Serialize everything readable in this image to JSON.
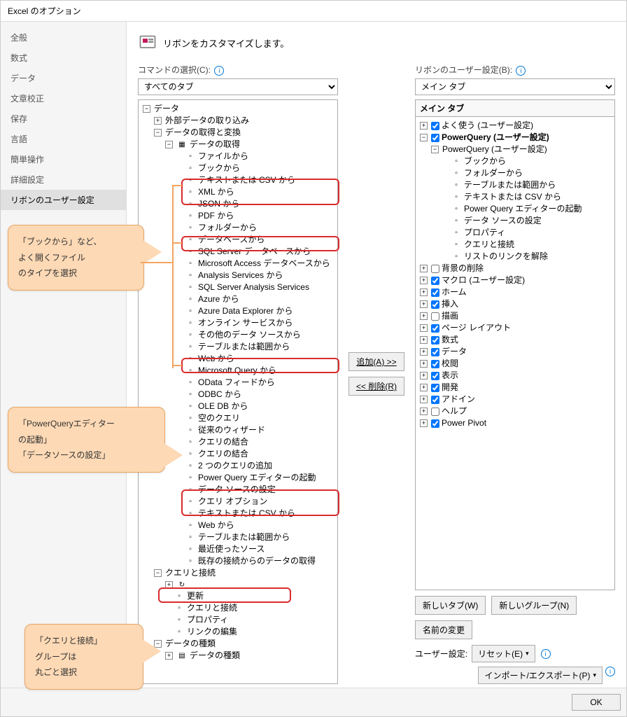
{
  "window_title": "Excel のオプション",
  "sidebar": {
    "items": [
      "全般",
      "数式",
      "データ",
      "文章校正",
      "保存",
      "言語",
      "簡単操作",
      "詳細設定",
      "リボンのユーザー設定"
    ]
  },
  "heading": "リボンをカスタマイズします。",
  "left_pane": {
    "label": "コマンドの選択(C):",
    "dropdown_value": "すべてのタブ",
    "root": "データ",
    "group1": "外部データの取り込み",
    "group2": "データの取得と変換",
    "group2_sub": "データの取得",
    "leaves_a": [
      "ファイルから",
      "ブックから",
      "テキストまたは CSV から",
      "XML から",
      "JSON から",
      "PDF から",
      "フォルダーから",
      "データベースから",
      "SQL Server データベースから",
      "Microsoft Access データベースから",
      "Analysis Services から",
      "SQL Server Analysis Services",
      "Azure から",
      "Azure Data Explorer から",
      "オンライン サービスから",
      "その他のデータ ソースから",
      "テーブルまたは範囲から",
      "Web から",
      "Microsoft Query から",
      "OData フィードから",
      "ODBC から",
      "OLE DB から",
      "空のクエリ",
      "従来のウィザード",
      "クエリの結合",
      "クエリの結合",
      "2 つのクエリの追加",
      "Power Query エディターの起動",
      "データ ソースの設定",
      "クエリ オプション"
    ],
    "leaves_b": [
      "テキストまたは CSV から",
      "Web から",
      "テーブルまたは範囲から",
      "最近使ったソース",
      "既存の接続からのデータの取得"
    ],
    "group3": "クエリと接続",
    "leaves_c": [
      "",
      "更新",
      "クエリと接続",
      "プロパティ",
      "リンクの編集"
    ],
    "group4": "データの種類",
    "group4_sub": "データの種類"
  },
  "center_buttons": {
    "add": "追加(A) >>",
    "remove": "<< 削除(R)"
  },
  "right_pane": {
    "label": "リボンのユーザー設定(B):",
    "dropdown_value": "メイン タブ",
    "header": "メイン タブ",
    "item_freq": "よく使う (ユーザー設定)",
    "item_pq_root": "PowerQuery (ユーザー設定)",
    "item_pq_group": "PowerQuery (ユーザー設定)",
    "pq_leaves": [
      "ブックから",
      "フォルダーから",
      "テーブルまたは範囲から",
      "テキストまたは CSV から",
      "Power Query エディターの起動",
      "データ ソースの設定",
      "プロパティ",
      "クエリと接続",
      "リストのリンクを解除"
    ],
    "std_items": [
      {
        "label": "背景の削除",
        "checked": false
      },
      {
        "label": "マクロ (ユーザー設定)",
        "checked": true
      },
      {
        "label": "ホーム",
        "checked": true
      },
      {
        "label": "挿入",
        "checked": true
      },
      {
        "label": "描画",
        "checked": false
      },
      {
        "label": "ページ レイアウト",
        "checked": true
      },
      {
        "label": "数式",
        "checked": true
      },
      {
        "label": "データ",
        "checked": true
      },
      {
        "label": "校閲",
        "checked": true
      },
      {
        "label": "表示",
        "checked": true
      },
      {
        "label": "開発",
        "checked": true
      },
      {
        "label": "アドイン",
        "checked": true
      },
      {
        "label": "ヘルプ",
        "checked": false
      },
      {
        "label": "Power Pivot",
        "checked": true
      }
    ]
  },
  "bottom": {
    "new_tab": "新しいタブ(W)",
    "new_group": "新しいグループ(N)",
    "rename": "名前の変更",
    "user_settings_label": "ユーザー設定:",
    "reset": "リセット(E)",
    "import_export": "インポート/エクスポート(P)"
  },
  "footer": {
    "ok": "OK"
  },
  "callouts": {
    "c1": "「ブックから」など、\nよく開くファイル\nのタイプを選択",
    "c2": "「PowerQueryエディター\nの起動」\n「データソースの設定」",
    "c3": "「クエリと接続」\nグループは\n丸ごと選択"
  }
}
